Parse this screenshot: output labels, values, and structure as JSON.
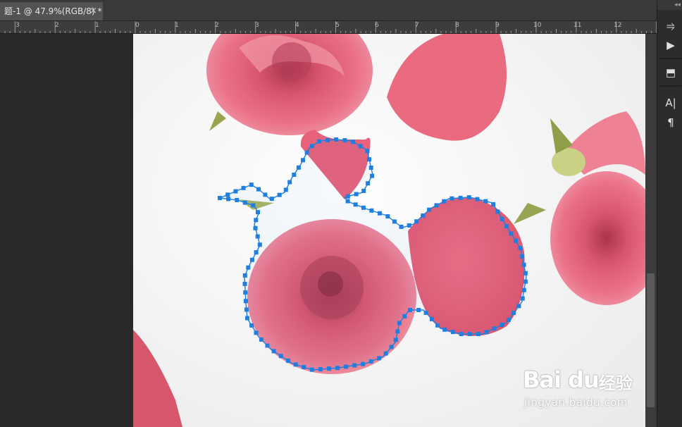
{
  "document_tab": {
    "title": "题-1 @ 47.9%(RGB/8) *",
    "close_glyph": "×"
  },
  "ruler": {
    "ticks": [
      "3",
      "2",
      "1",
      "0",
      "1",
      "2",
      "3",
      "4",
      "5",
      "6",
      "7",
      "8",
      "9",
      "10",
      "11",
      "12"
    ]
  },
  "right_panel": {
    "collapse_glyph": "◂◂",
    "tools": [
      {
        "name": "history-icon",
        "glyph": "⥤"
      },
      {
        "name": "play-icon",
        "glyph": "▶"
      },
      {
        "name": "cube-3d-icon",
        "glyph": "⬒"
      },
      {
        "name": "character-icon",
        "glyph": "A|"
      },
      {
        "name": "paragraph-icon",
        "glyph": "¶"
      }
    ]
  },
  "watermark": {
    "brand": "Bai du",
    "brand_cn": "经验",
    "url": "jingyan.baidu.com"
  },
  "colors": {
    "selection_path": "#1e7fe0",
    "canvas_bg": "#f6f4f4",
    "rose_main": "#e6627a"
  }
}
